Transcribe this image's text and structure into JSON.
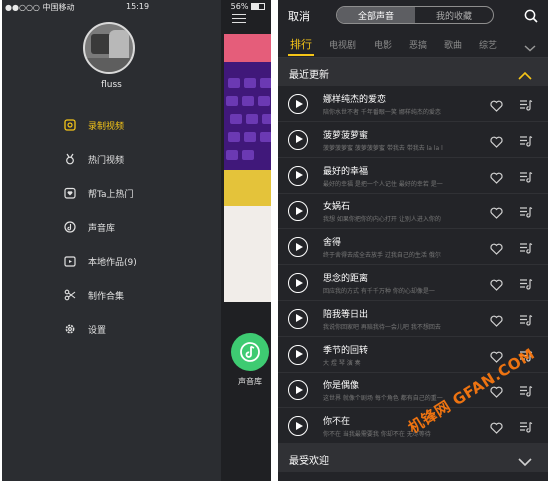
{
  "left_screen": {
    "statusbar": {
      "carrier": "●●○○○ 中国移动",
      "time": "15:19",
      "battery": "56%"
    },
    "username": "fluss",
    "menu": [
      {
        "label": "录制视频",
        "icon": "video-record-icon",
        "active": true
      },
      {
        "label": "热门视频",
        "icon": "medal-icon",
        "active": false
      },
      {
        "label": "帮Ta上热门",
        "icon": "heart-shield-icon",
        "active": false
      },
      {
        "label": "声音库",
        "icon": "sound-disc-icon",
        "active": false
      },
      {
        "label": "本地作品(9)",
        "icon": "local-folder-icon",
        "active": false
      },
      {
        "label": "制作合集",
        "icon": "scissors-icon",
        "active": false
      },
      {
        "label": "设置",
        "icon": "gear-icon",
        "active": false
      }
    ],
    "fab_label": "声音库",
    "accent": "#f5c518",
    "fab_color": "#3ecb72"
  },
  "right_screen": {
    "cancel": "取消",
    "segments": [
      "全部声音",
      "我的收藏"
    ],
    "tabs": [
      "排行",
      "电视剧",
      "电影",
      "恶搞",
      "歌曲",
      "综艺"
    ],
    "section_recent": "最近更新",
    "section_popular": "最受欢迎",
    "songs": [
      {
        "title": "娜样纯杰的爱恋",
        "sub": "陪你水世不者 千年番眼一笑 娜样纯杰的爱恋"
      },
      {
        "title": "菠萝菠萝蜜",
        "sub": "菠萝菠萝蜜 菠萝菠萝蜜 带我去 带我去 la la l"
      },
      {
        "title": "最好的幸福",
        "sub": "最好的幸福 是把一个人记住 最好的幸若 是一"
      },
      {
        "title": "女娲石",
        "sub": "我想 如果你把你的内心打开 让别人进入你的"
      },
      {
        "title": "舍得",
        "sub": "终于舍得去成全去放手 过我自己的生活 俄尔"
      },
      {
        "title": "思念的距离",
        "sub": "回应我的方式 有千千万种 你的心却像是一"
      },
      {
        "title": "陪我等日出",
        "sub": "我说你回家吧 再赔我待一会儿吧 我不想回去"
      },
      {
        "title": "季节的回转",
        "sub": "大 煜 琴 演 奏"
      },
      {
        "title": "你是偶像",
        "sub": "这世界 就像个剧场 每个角色 都有自己的重一"
      },
      {
        "title": "你不在",
        "sub": "你不在 当我最需要我 你却不在 无尽等待"
      }
    ],
    "watermark": "机锋网 GFAN.COM",
    "accent": "#f5c518"
  }
}
